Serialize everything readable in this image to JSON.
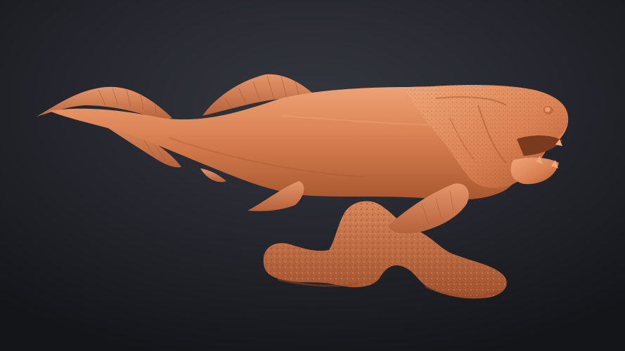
{
  "scene": {
    "subject": "dunkleosteus-sculpt",
    "background_top": "#2e3038",
    "background_bottom": "#15161a",
    "sculpt_base_color": "#d98052",
    "sculpt_shadow_color": "#a9572f",
    "sculpt_highlight_color": "#f0a77a"
  }
}
